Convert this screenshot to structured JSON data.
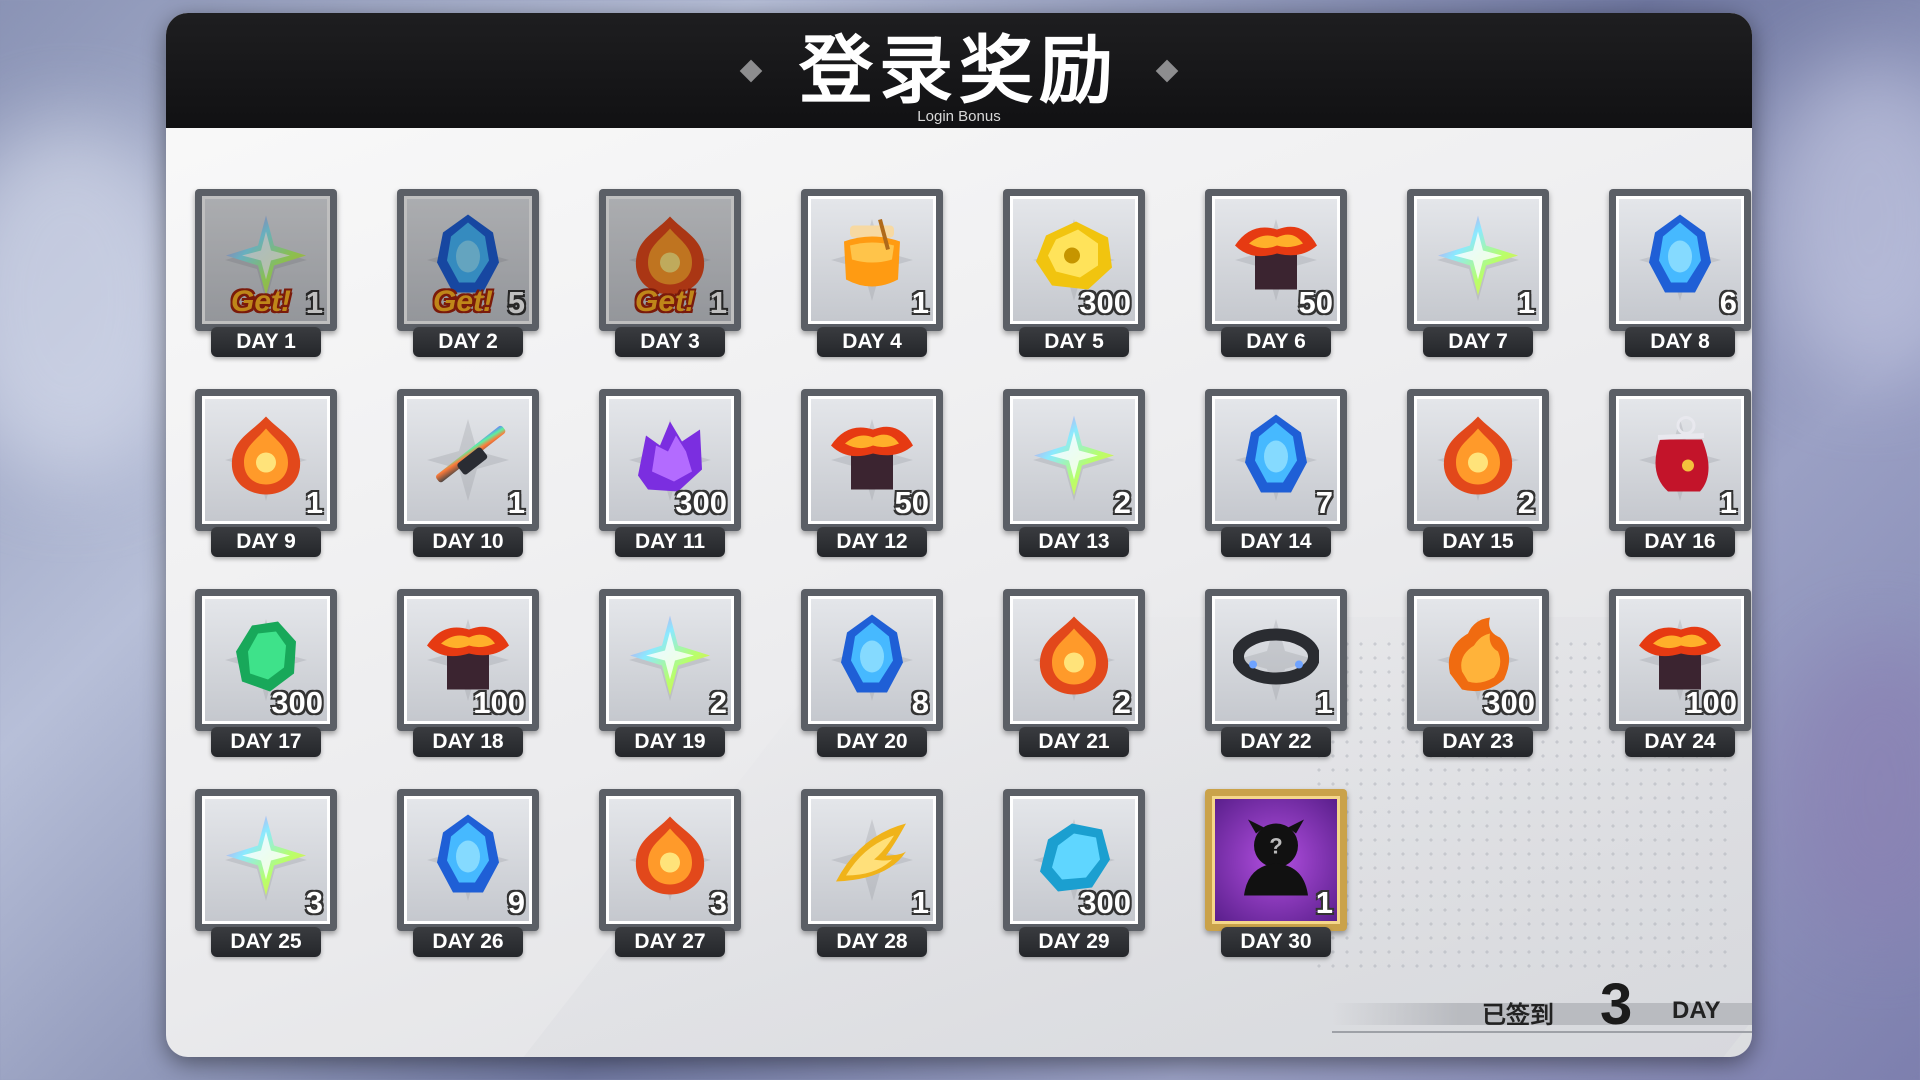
{
  "header": {
    "title": "登录奖励",
    "subtitle": "Login Bonus"
  },
  "rewards": [
    {
      "day": "DAY 1",
      "qty": "1",
      "icon": "rainbow-star-icon",
      "claimed": true,
      "get_label": "Get!"
    },
    {
      "day": "DAY 2",
      "qty": "5",
      "icon": "blue-crystal-icon",
      "claimed": true,
      "get_label": "Get!"
    },
    {
      "day": "DAY 3",
      "qty": "1",
      "icon": "fire-emblem-icon",
      "claimed": true,
      "get_label": "Get!"
    },
    {
      "day": "DAY 4",
      "qty": "1",
      "icon": "honey-jar-icon",
      "claimed": false
    },
    {
      "day": "DAY 5",
      "qty": "300",
      "icon": "gold-ore-icon",
      "claimed": false
    },
    {
      "day": "DAY 6",
      "qty": "50",
      "icon": "lava-chest-icon",
      "claimed": false
    },
    {
      "day": "DAY 7",
      "qty": "1",
      "icon": "rainbow-star-icon",
      "claimed": false
    },
    {
      "day": "DAY 8",
      "qty": "6",
      "icon": "blue-crystal-icon",
      "claimed": false
    },
    {
      "day": "DAY 9",
      "qty": "1",
      "icon": "fire-emblem-icon",
      "claimed": false
    },
    {
      "day": "DAY 10",
      "qty": "1",
      "icon": "rainbow-rifle-icon",
      "claimed": false
    },
    {
      "day": "DAY 11",
      "qty": "300",
      "icon": "purple-ore-icon",
      "claimed": false
    },
    {
      "day": "DAY 12",
      "qty": "50",
      "icon": "lava-chest-icon",
      "claimed": false
    },
    {
      "day": "DAY 13",
      "qty": "2",
      "icon": "rainbow-star-icon",
      "claimed": false
    },
    {
      "day": "DAY 14",
      "qty": "7",
      "icon": "blue-crystal-icon",
      "claimed": false
    },
    {
      "day": "DAY 15",
      "qty": "2",
      "icon": "fire-emblem-icon",
      "claimed": false
    },
    {
      "day": "DAY 16",
      "qty": "1",
      "icon": "red-pouch-icon",
      "claimed": false
    },
    {
      "day": "DAY 17",
      "qty": "300",
      "icon": "green-ore-icon",
      "claimed": false
    },
    {
      "day": "DAY 18",
      "qty": "100",
      "icon": "lava-chest-icon",
      "claimed": false
    },
    {
      "day": "DAY 19",
      "qty": "2",
      "icon": "rainbow-star-icon",
      "claimed": false
    },
    {
      "day": "DAY 20",
      "qty": "8",
      "icon": "blue-crystal-icon",
      "claimed": false
    },
    {
      "day": "DAY 21",
      "qty": "2",
      "icon": "fire-emblem-icon",
      "claimed": false
    },
    {
      "day": "DAY 22",
      "qty": "1",
      "icon": "black-collar-icon",
      "claimed": false
    },
    {
      "day": "DAY 23",
      "qty": "300",
      "icon": "fire-ore-icon",
      "claimed": false
    },
    {
      "day": "DAY 24",
      "qty": "100",
      "icon": "lava-chest-icon",
      "claimed": false
    },
    {
      "day": "DAY 25",
      "qty": "3",
      "icon": "rainbow-star-icon",
      "claimed": false
    },
    {
      "day": "DAY 26",
      "qty": "9",
      "icon": "blue-crystal-icon",
      "claimed": false
    },
    {
      "day": "DAY 27",
      "qty": "3",
      "icon": "fire-emblem-icon",
      "claimed": false
    },
    {
      "day": "DAY 28",
      "qty": "1",
      "icon": "golden-wing-icon",
      "claimed": false
    },
    {
      "day": "DAY 29",
      "qty": "300",
      "icon": "ice-ore-icon",
      "claimed": false
    },
    {
      "day": "DAY 30",
      "qty": "1",
      "icon": "mystery-character-icon",
      "claimed": false,
      "special": true
    }
  ],
  "footer": {
    "signed_label": "已签到",
    "signed_count": "3",
    "signed_unit": "DAY"
  },
  "colors": {
    "header_bg": "#111113",
    "get_text": "#ffb321",
    "special_frame": "#caa24a"
  }
}
